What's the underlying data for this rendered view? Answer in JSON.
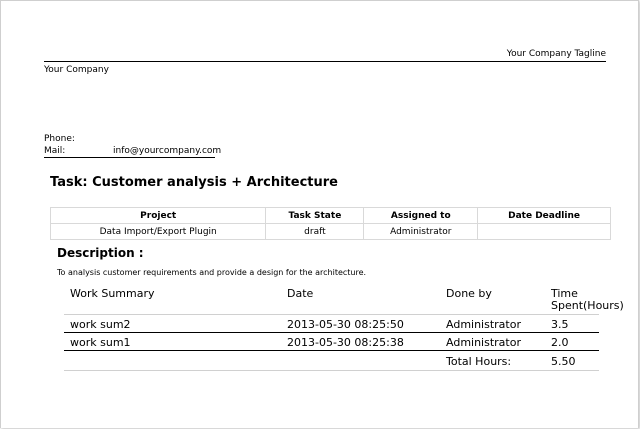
{
  "header": {
    "tagline": "Your Company Tagline",
    "company": "Your Company",
    "phone_label": "Phone:",
    "mail_label": "Mail:",
    "mail_value": "info@yourcompany.com"
  },
  "task": {
    "title": "Task: Customer analysis + Architecture"
  },
  "info_table": {
    "headers": [
      "Project",
      "Task State",
      "Assigned to",
      "Date Deadline"
    ],
    "row": [
      "Data Import/Export Plugin",
      "draft",
      "Administrator",
      ""
    ]
  },
  "description": {
    "heading": "Description :",
    "text": "To analysis customer requirements and provide a design for the architecture."
  },
  "work_table": {
    "headers": [
      "Work Summary",
      "Date",
      "Done by",
      "Time Spent(Hours)"
    ],
    "header_time_line1": "Time",
    "header_time_line2": "Spent(Hours)",
    "rows": [
      {
        "summary": "work sum2",
        "date": "2013-05-30 08:25:50",
        "done_by": "Administrator",
        "hours": "3.5"
      },
      {
        "summary": "work sum1",
        "date": "2013-05-30 08:25:38",
        "done_by": "Administrator",
        "hours": "2.0"
      }
    ],
    "total_label": "Total Hours:",
    "total_value": "5.50"
  }
}
